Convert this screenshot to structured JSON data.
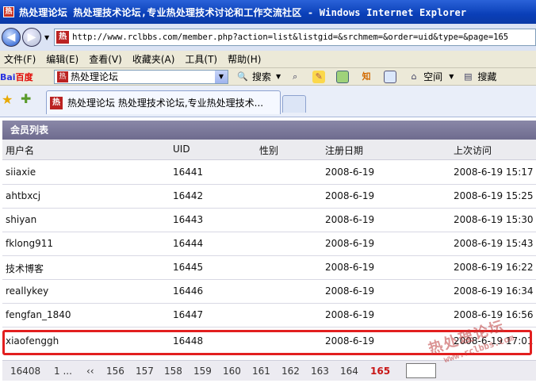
{
  "window": {
    "title": "热处理论坛  热处理技术论坛,专业热处理技术讨论和工作交流社区 - Windows Internet Explorer",
    "favicon_char": "热"
  },
  "address": {
    "url": "http://www.rclbbs.com/member.php?action=list&listgid=&srchmem=&order=uid&type=&page=165"
  },
  "menu": [
    "文件(F)",
    "编辑(E)",
    "查看(V)",
    "收藏夹(A)",
    "工具(T)",
    "帮助(H)"
  ],
  "toolbar": {
    "logo_main": "Bai",
    "logo_accent": "百度",
    "search_value": "热处理论坛",
    "search_button": "搜索",
    "zhi_label": "知",
    "space_label": "空间",
    "search_right": "搜藏"
  },
  "tab": {
    "label": "热处理论坛  热处理技术论坛,专业热处理技术..."
  },
  "panel": {
    "title": "会员列表",
    "columns": [
      "用户名",
      "UID",
      "性别",
      "注册日期",
      "上次访问"
    ],
    "rows": [
      {
        "username": "siiaxie",
        "uid": "16441",
        "gender": "",
        "registered": "2008-6-19",
        "last_visit": "2008-6-19 15:17"
      },
      {
        "username": "ahtbxcj",
        "uid": "16442",
        "gender": "",
        "registered": "2008-6-19",
        "last_visit": "2008-6-19 15:25"
      },
      {
        "username": "shiyan",
        "uid": "16443",
        "gender": "",
        "registered": "2008-6-19",
        "last_visit": "2008-6-19 15:30"
      },
      {
        "username": "fklong911",
        "uid": "16444",
        "gender": "",
        "registered": "2008-6-19",
        "last_visit": "2008-6-19 15:43"
      },
      {
        "username": "技术博客",
        "uid": "16445",
        "gender": "",
        "registered": "2008-6-19",
        "last_visit": "2008-6-19 16:22"
      },
      {
        "username": "reallykey",
        "uid": "16446",
        "gender": "",
        "registered": "2008-6-19",
        "last_visit": "2008-6-19 16:34"
      },
      {
        "username": "fengfan_1840",
        "uid": "16447",
        "gender": "",
        "registered": "2008-6-19",
        "last_visit": "2008-6-19 16:56"
      },
      {
        "username": "xiaofenggh",
        "uid": "16448",
        "gender": "",
        "registered": "2008-6-19",
        "last_visit": "2008-6-19 17:01"
      }
    ]
  },
  "pager": {
    "total": "16408",
    "first": "1 ...",
    "prev": "‹‹",
    "pages": [
      "156",
      "157",
      "158",
      "159",
      "160",
      "161",
      "162",
      "163",
      "164"
    ],
    "current": "165"
  },
  "watermark": {
    "main": "热处理论坛",
    "sub": "www.rclbbs.com"
  },
  "colors": {
    "highlight": "#e21f1f",
    "current_page": "#c81616",
    "panel_header": "#6e6b8e"
  }
}
